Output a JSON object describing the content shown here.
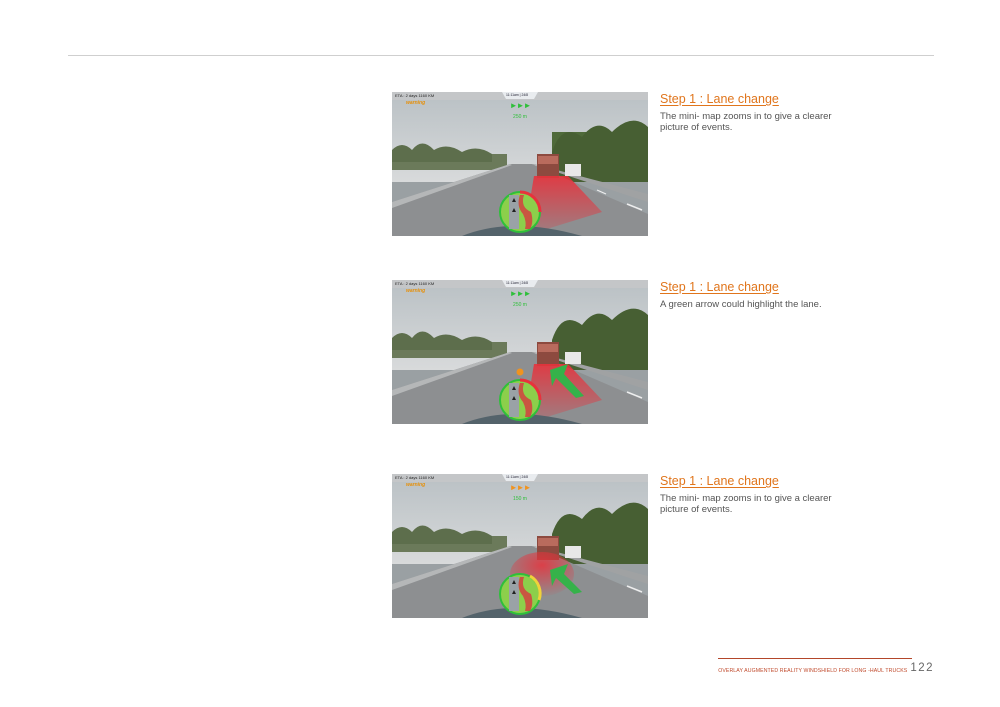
{
  "document": {
    "footer_title": "OVERLAY AUGMENTED REALITY WINDSHIELD FOR LONG -HAUL TRUCKS",
    "page_number": "122"
  },
  "steps": [
    {
      "title": "Step 1 : Lane change",
      "description": "The mini- map zooms in to give a clearer picture of events.",
      "screenshot": {
        "eta": "ETA : 2 days      1160 KM",
        "time": "11:11am | 24/8",
        "arrows": "►►►",
        "arrow_color": "#2fbf3a",
        "distance": "250 m",
        "distance_color": "#2fbf3a",
        "warning": "warning",
        "green_arrow": false
      }
    },
    {
      "title": "Step 1 : Lane change",
      "description": "A green arrow could highlight the lane.",
      "screenshot": {
        "eta": "ETA : 2 days      1160 KM",
        "time": "11:11am | 24/8",
        "arrows": "►►►",
        "arrow_color": "#2fbf3a",
        "distance": "250 m",
        "distance_color": "#2fbf3a",
        "warning": "warning",
        "green_arrow": true
      }
    },
    {
      "title": "Step 1 : Lane change",
      "description": "The mini- map zooms in to give a clearer picture of events.",
      "screenshot": {
        "eta": "ETA : 2 days      1160 KM",
        "time": "11:11am | 24/8",
        "arrows": "►►►",
        "arrow_color": "#f0931f",
        "distance": "150 m",
        "distance_color": "#2fbf3a",
        "warning": "warning",
        "green_arrow": true
      }
    }
  ],
  "colors": {
    "accent": "#e0751c",
    "hud_green": "#2fbf3a",
    "danger_red": "#e8323c"
  }
}
